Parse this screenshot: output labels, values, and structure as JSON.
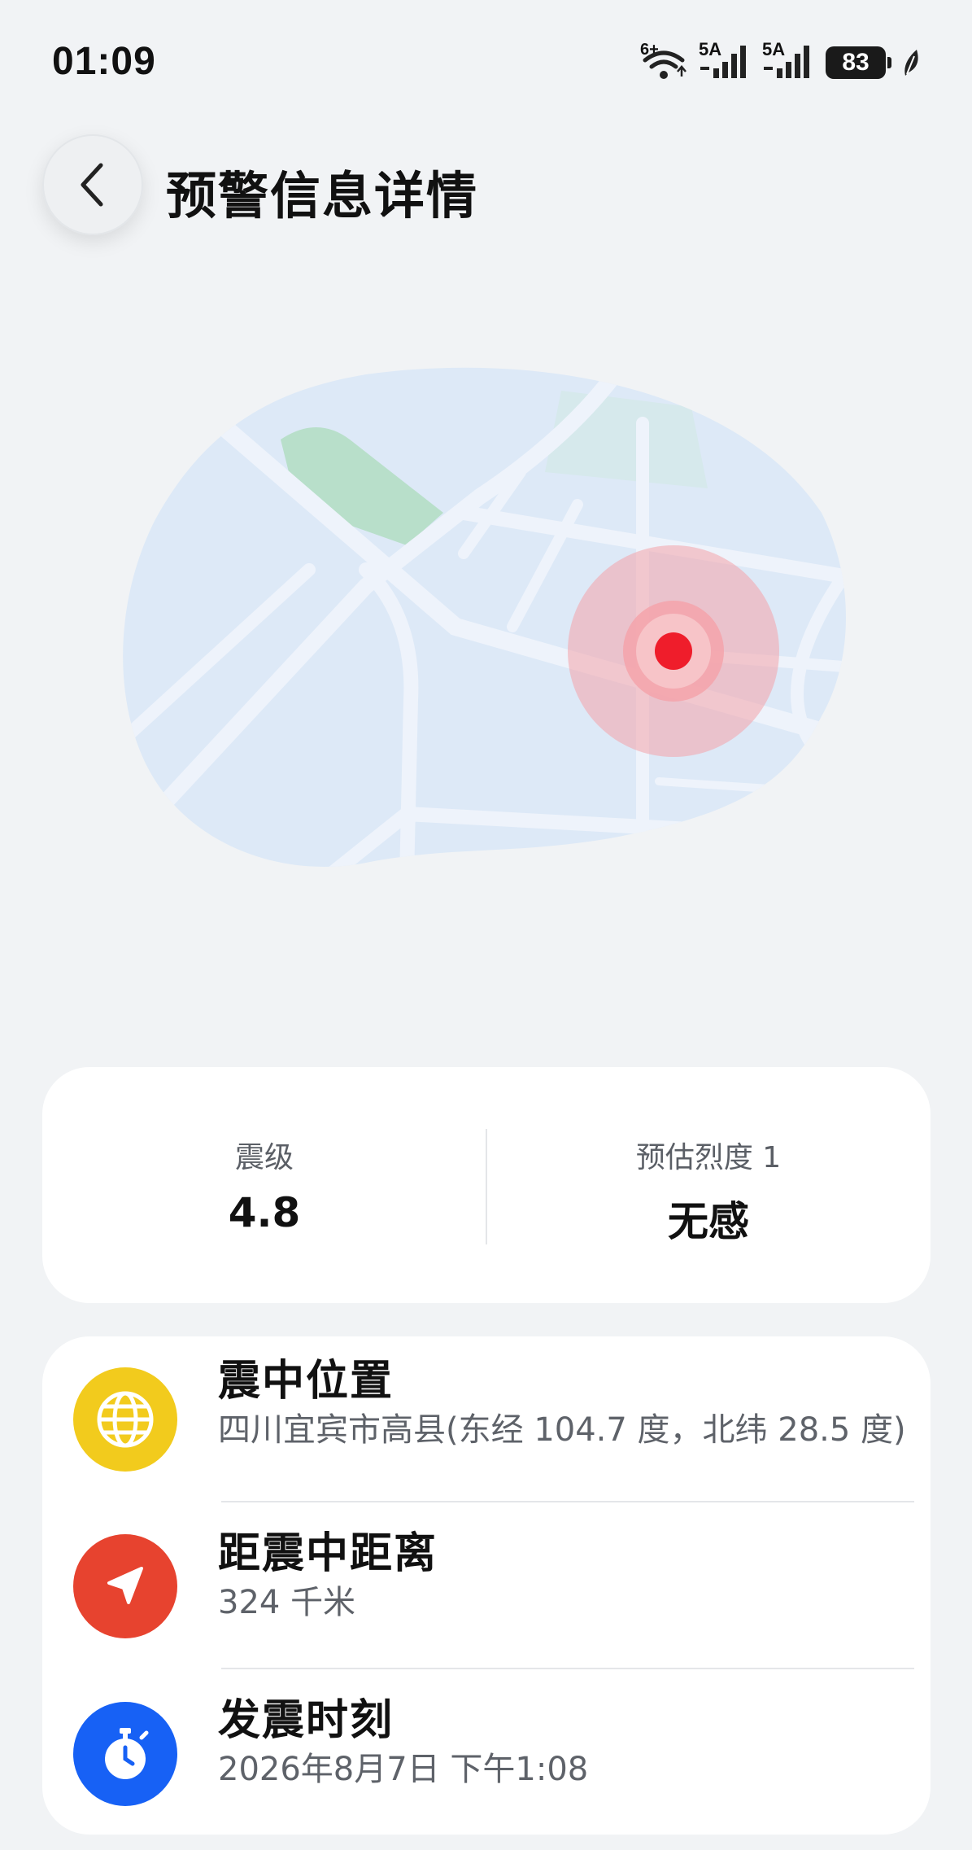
{
  "status_bar": {
    "time": "01:09",
    "wifi_label": "6+",
    "sim1_label": "5A",
    "sim2_label": "5A",
    "battery": "83",
    "icons": [
      "wifi-icon",
      "signal-icon",
      "signal-icon",
      "battery-icon",
      "leaf-icon"
    ]
  },
  "header": {
    "back_icon": "chevron-left-icon",
    "title": "预警信息详情"
  },
  "map": {
    "epicenter_color": "#ef1d2b",
    "land_color": "#dde9f7",
    "park_color": "#b6ddc9"
  },
  "magnitude_card": {
    "magnitude_label": "震级",
    "magnitude_value": "4.8",
    "intensity_label": "预估烈度 1",
    "intensity_value": "无感"
  },
  "info": {
    "items": [
      {
        "icon": "globe-icon",
        "icon_color": "#f2cb1d",
        "title": "震中位置",
        "value": "四川宜宾市高县(东经 104.7 度，北纬 28.5 度)"
      },
      {
        "icon": "navigation-arrow-icon",
        "icon_color": "#e7432f",
        "title": "距震中距离",
        "value": "324 千米"
      },
      {
        "icon": "stopwatch-icon",
        "icon_color": "#1761f5",
        "title": "发震时刻",
        "value": "2026年8月7日 下午1:08"
      }
    ]
  }
}
